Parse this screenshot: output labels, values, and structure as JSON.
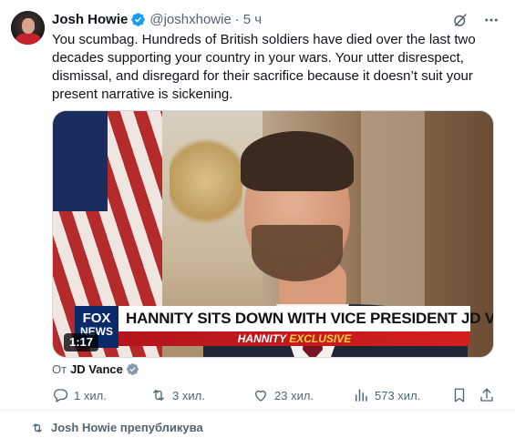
{
  "tweet": {
    "author_name": "Josh Howie",
    "author_handle": "@joshxhowie",
    "separator": "·",
    "time": "5 ч",
    "text": "You scumbag. Hundreds of British soldiers have died over the last two decades supporting your country in your wars. Your utter disrespect, dismissal, and disregard for their sacrifice because it doesn’t suit your present narrative is sickening."
  },
  "media": {
    "logo_top": "FOX",
    "logo_bottom": "NEWS",
    "banner_text": "HANNITY SITS DOWN WITH VICE PRESIDENT JD VANCE",
    "sub_left": "HANNITY",
    "sub_right": "EXCLUSIVE",
    "duration": "1:17"
  },
  "attribution": {
    "prefix": "От",
    "name": "JD Vance"
  },
  "actions": {
    "replies": "1 хил.",
    "reposts": "3 хил.",
    "likes": "23 хил.",
    "views": "573 хил."
  },
  "next_row": {
    "text": "Josh Howie препубликува"
  },
  "colors": {
    "verified_blue": "#1d9bf0",
    "muted": "#536471",
    "text": "#0f1419"
  },
  "icons": [
    "grok-icon",
    "more-icon",
    "verified-icon",
    "reply-icon",
    "repost-icon",
    "like-icon",
    "views-icon",
    "bookmark-icon",
    "share-icon"
  ]
}
